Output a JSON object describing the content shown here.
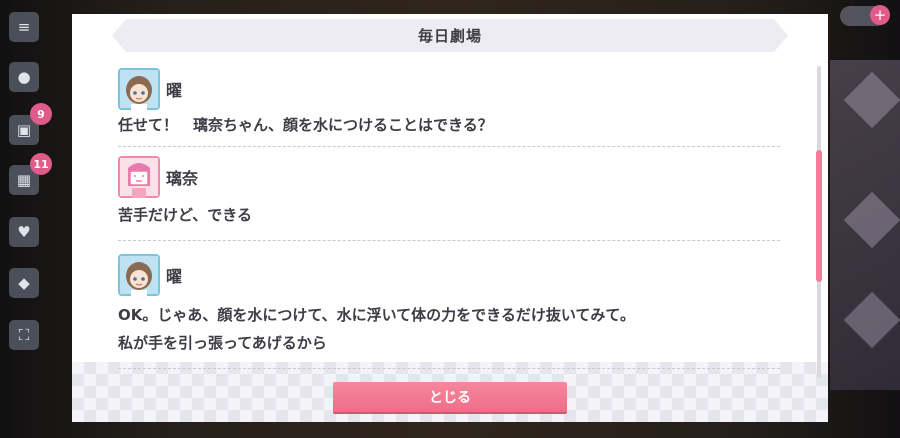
{
  "dialog": {
    "title": "毎日劇場",
    "close_label": "とじる",
    "entries": [
      {
        "speaker": "曜",
        "avatar": "you-avatar",
        "lines": [
          "任せて！　璃奈ちゃん、顔を水につけることはできる？"
        ]
      },
      {
        "speaker": "璃奈",
        "avatar": "rina-avatar",
        "lines": [
          "苦手だけど、できる"
        ]
      },
      {
        "speaker": "曜",
        "avatar": "you-avatar",
        "lines": [
          "OK。じゃあ、顔を水につけて、水に浮いて体の力をできるだけ抜いてみて。",
          "私が手を引っ張ってあげるから"
        ]
      }
    ]
  },
  "background": {
    "badges": [
      "9",
      "11"
    ],
    "icons": [
      "menu-icon",
      "chat-icon",
      "present-icon",
      "gift-icon",
      "heart-icon",
      "shirt-icon",
      "expand-icon"
    ]
  },
  "colors": {
    "accent_pink": "#ec6f88",
    "text": "#3d3d45",
    "title_bar": "#ececf2"
  }
}
